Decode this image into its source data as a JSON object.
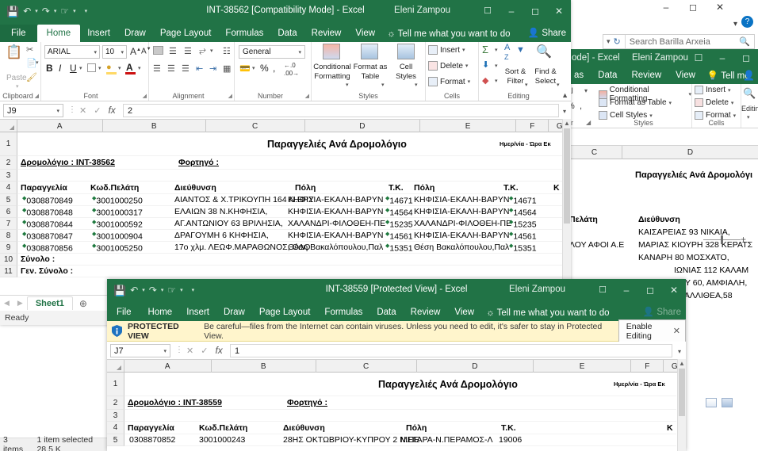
{
  "windows": {
    "front_top": {
      "title": "INT-38562  [Compatibility Mode]  -  Excel",
      "account": "Eleni Zampou",
      "quick_access": [
        "save-icon",
        "undo-icon",
        "redo-icon",
        "touch-mode-icon",
        "customize-icon"
      ],
      "ribbon_tabs": [
        "File",
        "Home",
        "Insert",
        "Draw",
        "Page Layout",
        "Formulas",
        "Data",
        "Review",
        "View"
      ],
      "active_tab": "Home",
      "tell_me": "Tell me what you want to do",
      "share": "Share",
      "groups": [
        "Clipboard",
        "Font",
        "Alignment",
        "Number",
        "Styles",
        "Cells",
        "Editing"
      ],
      "clipboard": {
        "paste": "Paste"
      },
      "font": {
        "name": "ARIAL",
        "size": "10",
        "grow": "A",
        "shrink": "A",
        "bold": "B",
        "italic": "I",
        "underline": "U"
      },
      "number": {
        "format": "General",
        "percent": "%",
        "comma": ",",
        "inc_dec": ".00"
      },
      "styles": [
        "Conditional Formatting",
        "Format as Table",
        "Cell Styles"
      ],
      "cells": [
        "Insert",
        "Delete",
        "Format"
      ],
      "editing": {
        "autosum": "Σ",
        "fill": "↓",
        "clear": "◆",
        "sort_filter": "Sort & Filter",
        "find_select": "Find & Select"
      },
      "name_box": "J9",
      "formula": "2",
      "columns": [
        "A",
        "B",
        "C",
        "D",
        "E",
        "F",
        "G"
      ],
      "rows": [
        {
          "num": "1",
          "cells": [
            {
              "col": "D",
              "text": "Παραγγελιές Ανά Δρομολόγιο",
              "style": "title"
            },
            {
              "col": "F",
              "text": "Ημερ/νία - Ώρα Εκ",
              "style": "tiny"
            }
          ]
        },
        {
          "num": "2",
          "cells": [
            {
              "col": "A",
              "text": "Δρομολόγιο : INT-38562",
              "style": "underline-bold"
            },
            {
              "col": "C",
              "text": "Φορτηγό :",
              "style": "underline-bold"
            }
          ]
        },
        {
          "num": "3",
          "cells": []
        },
        {
          "num": "4",
          "cells": [
            {
              "col": "A",
              "text": "Παραγγελία",
              "style": "bold"
            },
            {
              "col": "B",
              "text": "Κωδ.Πελάτη",
              "style": "bold"
            },
            {
              "col": "C",
              "text": "Διεύθυνση",
              "style": "bold"
            },
            {
              "col": "D",
              "text": "Πόλη",
              "style": "bold"
            },
            {
              "col": "E",
              "text": "Τ.Κ.",
              "style": "bold"
            },
            {
              "col": "F",
              "text": "Πόλη",
              "style": "bold"
            },
            {
              "col": "G",
              "text": "Τ.Κ.",
              "style": "bold"
            },
            {
              "col": "H",
              "text": "Κ",
              "style": "bold"
            }
          ]
        },
        {
          "num": "5",
          "cells": [
            {
              "col": "A",
              "text": "0308870849",
              "flag": true
            },
            {
              "col": "B",
              "text": "3001000250",
              "flag": true
            },
            {
              "col": "C",
              "text": "ΑΙΑΝΤΟΣ & Χ.ΤΡΙΚΟΥΠΗ 164 Ν.ΕΡΥ"
            },
            {
              "col": "D",
              "text": "ΚΗΦΙΣΙΑ-ΕΚΑΛΗ-ΒΑΡΥΝ"
            },
            {
              "col": "E",
              "text": "14671",
              "flag": true
            },
            {
              "col": "F",
              "text": "ΚΗΦΙΣΙΑ-ΕΚΑΛΗ-ΒΑΡΥΝ"
            },
            {
              "col": "G",
              "text": "14671",
              "flag": true
            }
          ]
        },
        {
          "num": "6",
          "cells": [
            {
              "col": "A",
              "text": "0308870848",
              "flag": true
            },
            {
              "col": "B",
              "text": "3001000317",
              "flag": true
            },
            {
              "col": "C",
              "text": "ΕΛΑΙΩΝ 38 Ν.ΚΗΦΗΣΙΑ,"
            },
            {
              "col": "D",
              "text": "ΚΗΦΙΣΙΑ-ΕΚΑΛΗ-ΒΑΡΥΝ"
            },
            {
              "col": "E",
              "text": "14564",
              "flag": true
            },
            {
              "col": "F",
              "text": "ΚΗΦΙΣΙΑ-ΕΚΑΛΗ-ΒΑΡΥΝ"
            },
            {
              "col": "G",
              "text": "14564",
              "flag": true
            }
          ]
        },
        {
          "num": "7",
          "cells": [
            {
              "col": "A",
              "text": "0308870844",
              "flag": true
            },
            {
              "col": "B",
              "text": "3001000592",
              "flag": true
            },
            {
              "col": "C",
              "text": "ΑΓ.ΑΝΤΩΝΙΟΥ 63 ΒΡΙΛΗΣΙΑ,"
            },
            {
              "col": "D",
              "text": "ΧΑΛΑΝΔΡΙ-ΦΙΛΟΘΕΗ-ΠΕ"
            },
            {
              "col": "E",
              "text": "15235",
              "flag": true
            },
            {
              "col": "F",
              "text": "ΧΑΛΑΝΔΡΙ-ΦΙΛΟΘΕΗ-ΠΕ"
            },
            {
              "col": "G",
              "text": "15235",
              "flag": true
            }
          ]
        },
        {
          "num": "8",
          "cells": [
            {
              "col": "A",
              "text": "0308870847",
              "flag": true
            },
            {
              "col": "B",
              "text": "3001000904",
              "flag": true
            },
            {
              "col": "C",
              "text": "ΔΡΑΓΟΥΜΗ 6 ΚΗΦΗΣΙΑ,"
            },
            {
              "col": "D",
              "text": "ΚΗΦΙΣΙΑ-ΕΚΑΛΗ-ΒΑΡΥΝ"
            },
            {
              "col": "E",
              "text": "14561",
              "flag": true
            },
            {
              "col": "F",
              "text": "ΚΗΦΙΣΙΑ-ΕΚΑΛΗ-ΒΑΡΥΝ"
            },
            {
              "col": "G",
              "text": "14561",
              "flag": true
            }
          ]
        },
        {
          "num": "9",
          "cells": [
            {
              "col": "A",
              "text": "0308870856",
              "flag": true
            },
            {
              "col": "B",
              "text": "3001005250",
              "flag": true
            },
            {
              "col": "C",
              "text": "17ο χλμ. ΛΕΩΦ.ΜΑΡΑΘΩΝΟΣ, ΟΔΟ"
            },
            {
              "col": "D",
              "text": "Θέση Βακαλόπουλου,Παλ"
            },
            {
              "col": "E",
              "text": "15351",
              "flag": true
            },
            {
              "col": "F",
              "text": "Θέση Βακαλόπουλου,Παλ"
            },
            {
              "col": "G",
              "text": "15351",
              "flag": true
            }
          ]
        },
        {
          "num": "10",
          "cells": [
            {
              "col": "A",
              "text": "Σύνολο :",
              "style": "bold"
            }
          ]
        },
        {
          "num": "11",
          "cells": [
            {
              "col": "A",
              "text": "Γεν. Σύνολο :",
              "style": "bold"
            }
          ]
        }
      ],
      "sheet_tab": "Sheet1",
      "add_sheet": "+",
      "status": "Ready"
    },
    "front_bottom": {
      "title": "INT-38559  [Protected View]  -  Excel",
      "account": "Eleni Zampou",
      "ribbon_tabs": [
        "File",
        "Home",
        "Insert",
        "Draw",
        "Page Layout",
        "Formulas",
        "Data",
        "Review",
        "View"
      ],
      "tell_me": "Tell me what you want to do",
      "share": "Share",
      "protected_view": {
        "label": "PROTECTED VIEW",
        "message": "Be careful—files from the Internet can contain viruses. Unless you need to edit, it's safer to stay in Protected View.",
        "button": "Enable Editing",
        "close": "✕"
      },
      "name_box": "J7",
      "formula": "1",
      "columns": [
        "A",
        "B",
        "C",
        "D",
        "E",
        "F",
        "G"
      ],
      "rows": [
        {
          "num": "1",
          "cells": [
            {
              "col": "D",
              "text": "Παραγγελιές Ανά Δρομολόγιο",
              "style": "title"
            },
            {
              "col": "F",
              "text": "Ημερ/νία - Ώρα Εκ",
              "style": "tiny"
            }
          ]
        },
        {
          "num": "2",
          "cells": [
            {
              "col": "A",
              "text": "Δρομολόγιο : INT-38559",
              "style": "underline-bold"
            },
            {
              "col": "C",
              "text": "Φορτηγό :",
              "style": "underline-bold"
            }
          ]
        },
        {
          "num": "3",
          "cells": []
        },
        {
          "num": "4",
          "cells": [
            {
              "col": "A",
              "text": "Παραγγελία",
              "style": "bold"
            },
            {
              "col": "B",
              "text": "Κωδ.Πελάτη",
              "style": "bold"
            },
            {
              "col": "C",
              "text": "Διεύθυνση",
              "style": "bold"
            },
            {
              "col": "D",
              "text": "Πόλη",
              "style": "bold"
            },
            {
              "col": "E",
              "text": "Τ.Κ.",
              "style": "bold"
            },
            {
              "col": "H",
              "text": "Κ",
              "style": "bold"
            }
          ]
        },
        {
          "num": "5",
          "cells": [
            {
              "col": "A",
              "text": "0308870852"
            },
            {
              "col": "B",
              "text": "3001000243"
            },
            {
              "col": "C",
              "text": "28ΗΣ ΟΚΤΩΒΡΙΟΥ-ΚΥΠΡΟΥ 2 Ν.ΠΕ"
            },
            {
              "col": "D",
              "text": "ΜΕΓΑΡΑ-Ν.ΠΕΡΑΜΟΣ-Λ"
            },
            {
              "col": "E",
              "text": "19006"
            }
          ]
        }
      ]
    },
    "background_excel": {
      "title": "ode]  -  Excel",
      "account": "Eleni Zampou",
      "ribbon_tabs": [
        "as",
        "Data",
        "Review",
        "View"
      ],
      "tell_me": "Tell me",
      "groups": [
        "Styles",
        "Cells",
        "Editing"
      ],
      "styles": [
        "Conditional Formatting",
        "Format as Table",
        "Cell Styles"
      ],
      "cells": [
        "Insert",
        "Delete",
        "Format"
      ],
      "editing_label": "Editin",
      "columns": [
        "C",
        "D"
      ],
      "sheet_title": "Παραγγελιές Ανά Δρομολόγι",
      "header_client": "Πελάτη",
      "header_address": "Διεύθυνση",
      "rows": [
        {
          "client": "",
          "address": "ΚΑΙΣΑΡΕΙΑΣ 93 ΝΙΚΑΙΑ,"
        },
        {
          "client": "ΛΟΥ ΑΦΟΙ Α.Ε",
          "address": "ΜΑΡΙΑΣ ΚΙΟΥΡΗ 328 ΚΕΡΑΤΣ"
        },
        {
          "client": "",
          "address": "ΚΑΝΑΡΗ 80 ΜΟΣΧΑΤΟ,"
        },
        {
          "client": "",
          "address": "ΙΩΝΙΑΣ 112 ΚΑΛΑΜ"
        },
        {
          "client": "",
          "address": "ΤΟΥ 60, ΑΜΦΙΑΛΗ,"
        },
        {
          "client": "",
          "address": ", ΚΑΛΛΙΘΕΑ,58"
        }
      ]
    },
    "explorer": {
      "search_placeholder": "Search Barilla Arxeia",
      "refresh_icon": "refresh-icon",
      "status_items": [
        "3 items",
        "1 item selected  28.5 K"
      ],
      "view_icons": [
        "details-view-icon",
        "large-icons-view-icon"
      ]
    }
  }
}
